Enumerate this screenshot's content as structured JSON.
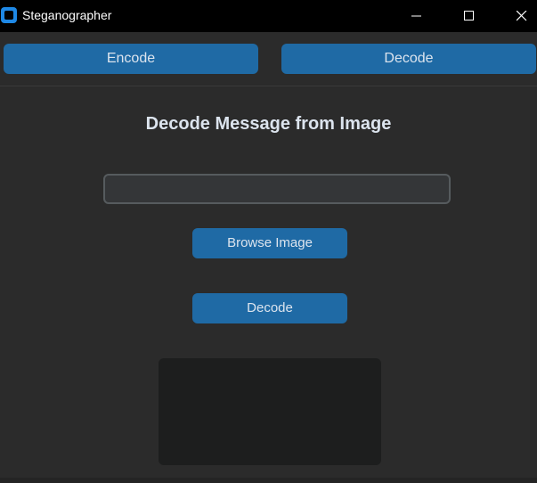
{
  "window": {
    "title": "Steganographer",
    "app_icon": "steganographer-app-icon",
    "controls": [
      "minimize-icon",
      "maximize-icon",
      "close-icon"
    ]
  },
  "tabs": {
    "encode_label": "Encode",
    "decode_label": "Decode"
  },
  "main": {
    "heading": "Decode Message from Image",
    "image_path_value": "",
    "image_path_placeholder": "",
    "browse_label": "Browse Image",
    "decode_label": "Decode",
    "output_text": ""
  },
  "colors": {
    "accent": "#1f6aa5",
    "background": "#2b2b2b",
    "titlebar": "#000000",
    "input_bg": "#343638",
    "output_bg": "#1d1e1e",
    "text": "#dce4ee"
  }
}
